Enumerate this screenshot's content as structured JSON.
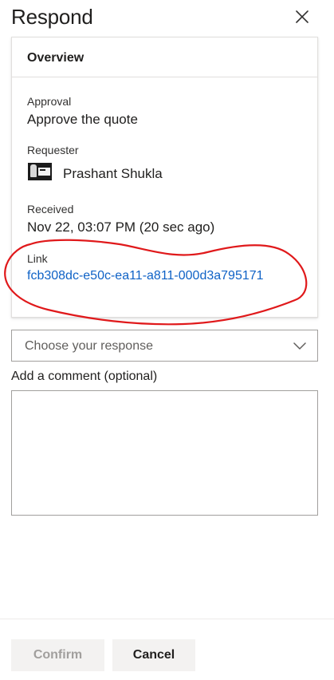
{
  "panel": {
    "title": "Respond",
    "close_icon": "close-icon"
  },
  "overview": {
    "title": "Overview",
    "approval_label": "Approval",
    "approval_value": "Approve the quote",
    "requester_label": "Requester",
    "requester_name": "Prashant Shukla",
    "received_label": "Received",
    "received_value": "Nov 22, 03:07 PM (20 sec ago)",
    "link_label": "Link",
    "link_value": "fcb308dc-e50c-ea11-a811-000d3a795171"
  },
  "response": {
    "placeholder": "Choose your response",
    "chevron_icon": "chevron-down-icon"
  },
  "comment": {
    "label": "Add a comment (optional)",
    "value": ""
  },
  "footer": {
    "confirm_label": "Confirm",
    "cancel_label": "Cancel"
  },
  "colors": {
    "link": "#0f62c6",
    "annotation": "#e0191b",
    "disabled_text": "#a19f9d",
    "button_bg": "#f3f2f1"
  }
}
